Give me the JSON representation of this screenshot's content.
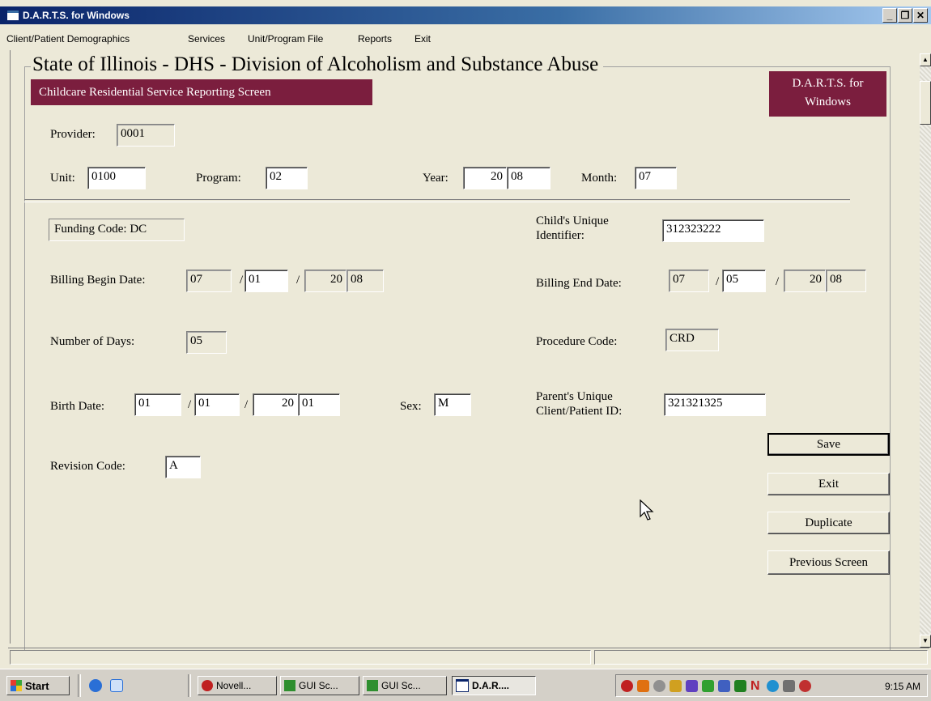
{
  "window": {
    "title": "D.A.R.T.S. for Windows"
  },
  "menu": [
    "Client/Patient Demographics",
    "Services",
    "Unit/Program File",
    "Reports",
    "Exit"
  ],
  "header": {
    "title": "State of Illinois - DHS - Division of Alcoholism and Substance Abuse",
    "subtitle": "Childcare Residential Service Reporting Screen",
    "brand_line1": "D.A.R.T.S. for",
    "brand_line2": "Windows"
  },
  "top": {
    "provider_label": "Provider:",
    "provider": "0001",
    "unit_label": "Unit:",
    "unit": "0100",
    "program_label": "Program:",
    "program": "02",
    "year_label": "Year:",
    "year_century": "20",
    "year_yy": "08",
    "month_label": "Month:",
    "month": "07"
  },
  "form": {
    "funding": "Funding Code: DC",
    "child_id_label_1": "Child's Unique",
    "child_id_label_2": "Identifier:",
    "child_id": "312323222",
    "billing_begin_label": "Billing Begin Date:",
    "begin_mm": "07",
    "begin_dd": "01",
    "begin_cc": "20",
    "begin_yy": "08",
    "billing_end_label": "Billing End Date:",
    "end_mm": "07",
    "end_dd": "05",
    "end_cc": "20",
    "end_yy": "08",
    "days_label": "Number of Days:",
    "days": "05",
    "procedure_label": "Procedure Code:",
    "procedure": "CRD",
    "birth_label": "Birth Date:",
    "birth_mm": "01",
    "birth_dd": "01",
    "birth_cc": "20",
    "birth_yy": "01",
    "sex_label": "Sex:",
    "sex": "M",
    "parent_label_1": "Parent's Unique",
    "parent_label_2": "Client/Patient ID:",
    "parent_id": "321321325",
    "revision_label": "Revision Code:",
    "revision": "A",
    "date_sep": "/"
  },
  "buttons": {
    "save": "Save",
    "exit": "Exit",
    "duplicate": "Duplicate",
    "previous": "Previous Screen"
  },
  "taskbar": {
    "start": "Start",
    "items": [
      "Novell...",
      "GUI Sc...",
      "GUI Sc...",
      "D.A.R...."
    ],
    "clock": "9:15 AM"
  }
}
